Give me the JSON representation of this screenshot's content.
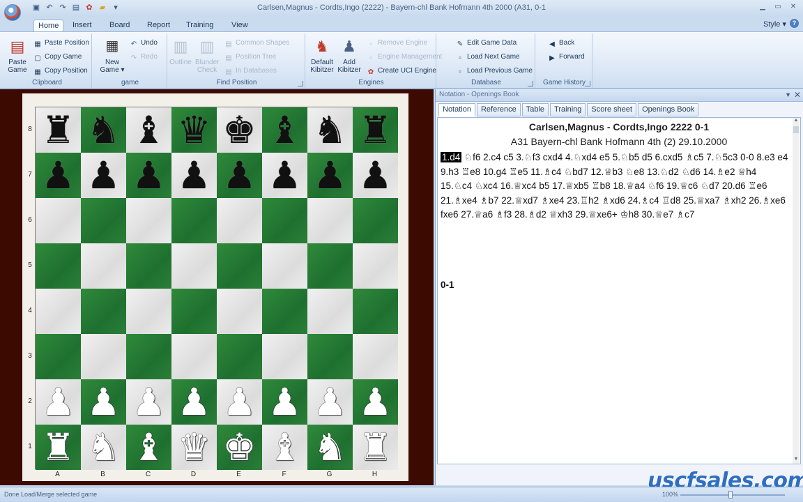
{
  "window": {
    "title": "Carlsen,Magnus - Cordts,Ingo (2222) - Bayern-chl Bank Hofmann 4th 2000 (A31, 0-1",
    "qat_icons": [
      "save",
      "undo",
      "redo",
      "print",
      "settings",
      "folder",
      "dropdown"
    ]
  },
  "ribbon_tabs": [
    "Home",
    "Insert",
    "Board",
    "Report",
    "Training",
    "View"
  ],
  "style_menu": "Style",
  "ribbon": {
    "clipboard": {
      "label": "Clipboard",
      "paste_game": "Paste Game",
      "paste_position": "Paste Position",
      "copy_game": "Copy Game",
      "copy_position": "Copy Position"
    },
    "game": {
      "label": "game",
      "new_game": "New Game",
      "undo": "Undo",
      "redo": "Redo"
    },
    "find_position": {
      "label": "Find Position",
      "outline": "Outline",
      "blunder": "Blunder Check",
      "b1": "Common Shapes",
      "b2": "Position Tree",
      "b3": "In Databases"
    },
    "engines": {
      "label": "Engines",
      "default_kibitzer": "Default Kibitzer",
      "add_kibitzer": "Add Kibitzer",
      "create_uci": "Create UCI Engine",
      "e1": "Remove Engine",
      "e2": "Engine Management"
    },
    "database": {
      "label": "Database",
      "edit_game_data": "Edit Game Data",
      "load_next_game": "Load Next Game",
      "load_previous_game": "Load Previous Game"
    },
    "game_history": {
      "label": "Game History",
      "back": "Back",
      "forward": "Forward"
    }
  },
  "board": {
    "ranks": [
      "8",
      "7",
      "6",
      "5",
      "4",
      "3",
      "2",
      "1"
    ],
    "files": [
      "A",
      "B",
      "C",
      "D",
      "E",
      "F",
      "G",
      "H"
    ],
    "position": [
      [
        "br",
        "bn",
        "bb",
        "bq",
        "bk",
        "bb",
        "bn",
        "br"
      ],
      [
        "bp",
        "bp",
        "bp",
        "bp",
        "bp",
        "bp",
        "bp",
        "bp"
      ],
      [
        "",
        "",
        "",
        "",
        "",
        "",
        "",
        ""
      ],
      [
        "",
        "",
        "",
        "",
        "",
        "",
        "",
        ""
      ],
      [
        "",
        "",
        "",
        "",
        "",
        "",
        "",
        ""
      ],
      [
        "",
        "",
        "",
        "",
        "",
        "",
        "",
        ""
      ],
      [
        "wp",
        "wp",
        "wp",
        "wp",
        "wp",
        "wp",
        "wp",
        "wp"
      ],
      [
        "wr",
        "wn",
        "wb",
        "wq",
        "wk",
        "wb",
        "wn",
        "wr"
      ]
    ],
    "light_color": "#e6e6e6",
    "dark_color": "#247a33"
  },
  "notation_pane": {
    "caption": "Notation - Openings Book",
    "tabs": [
      "Notation",
      "Reference",
      "Table",
      "Training",
      "Score sheet",
      "Openings Book"
    ],
    "header_line1": "Carlsen,Magnus - Cordts,Ingo  2222  0-1",
    "header_line2": "A31  Bayern-chl Bank Hofmann 4th (2) 29.10.2000",
    "current_move": "1.d4",
    "moves_rest": " ♘f6  2.c4  c5  3.♘f3  cxd4  4.♘xd4  e5  5.♘b5  d5  6.cxd5  ♗c5  7.♘5c3  0-0  8.e3  e4  9.h3  ♖e8  10.g4  ♖e5  11.♗c4  ♘bd7  12.♕b3  ♘e8  13.♘d2  ♘d6  14.♗e2  ♕h4  15.♘c4  ♘xc4  16.♕xc4  b5  17.♕xb5  ♖b8  18.♕a4  ♘f6  19.♕c6  ♘d7  20.d6  ♖e6  21.♗xe4  ♗b7  22.♕xd7  ♗xe4  23.♖h2  ♗xd6  24.♗c4  ♖d8  25.♕xa7  ♗xh2  26.♗xe6  fxe6  27.♕a6  ♗f3  28.♗d2  ♕xh3  29.♕xe6+  ♔h8  30.♕e7  ♗c7",
    "result": "0-1"
  },
  "watermark": "uscfsales.com",
  "statusbar": {
    "text": "Done   Load/Merge selected game",
    "zoom": "100%"
  }
}
